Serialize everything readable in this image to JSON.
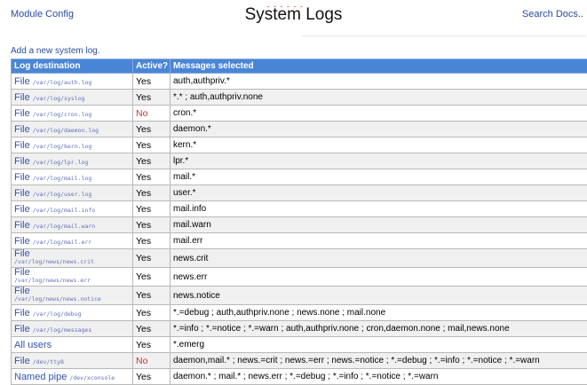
{
  "header": {
    "left_link": "Module Config",
    "title": "System Logs",
    "title_decoration": "- - - - - -",
    "right_link": "Search Docs.."
  },
  "add_link": "Add a new system log.",
  "table": {
    "columns": [
      "Log destination",
      "Active?",
      "Messages selected"
    ],
    "rows": [
      {
        "kind": "File",
        "path": "/var/log/auth.log",
        "active": "Yes",
        "messages": "auth,authpriv.*"
      },
      {
        "kind": "File",
        "path": "/var/log/syslog",
        "active": "Yes",
        "messages": "*.* ; auth,authpriv.none"
      },
      {
        "kind": "File",
        "path": "/var/log/cron.log",
        "active": "No",
        "messages": "cron.*"
      },
      {
        "kind": "File",
        "path": "/var/log/daemon.log",
        "active": "Yes",
        "messages": "daemon.*"
      },
      {
        "kind": "File",
        "path": "/var/log/kern.log",
        "active": "Yes",
        "messages": "kern.*"
      },
      {
        "kind": "File",
        "path": "/var/log/lpr.log",
        "active": "Yes",
        "messages": "lpr.*"
      },
      {
        "kind": "File",
        "path": "/var/log/mail.log",
        "active": "Yes",
        "messages": "mail.*"
      },
      {
        "kind": "File",
        "path": "/var/log/user.log",
        "active": "Yes",
        "messages": "user.*"
      },
      {
        "kind": "File",
        "path": "/var/log/mail.info",
        "active": "Yes",
        "messages": "mail.info"
      },
      {
        "kind": "File",
        "path": "/var/log/mail.warn",
        "active": "Yes",
        "messages": "mail.warn"
      },
      {
        "kind": "File",
        "path": "/var/log/mail.err",
        "active": "Yes",
        "messages": "mail.err"
      },
      {
        "kind": "File",
        "path": "/var/log/news/news.crit",
        "active": "Yes",
        "messages": "news.crit",
        "tall": true
      },
      {
        "kind": "File",
        "path": "/var/log/news/news.err",
        "active": "Yes",
        "messages": "news.err",
        "tall": true
      },
      {
        "kind": "File",
        "path": "/var/log/news/news.notice",
        "active": "Yes",
        "messages": "news.notice",
        "tall": true
      },
      {
        "kind": "File",
        "path": "/var/log/debug",
        "active": "Yes",
        "messages": "*.=debug ; auth,authpriv.none ; news.none ; mail.none"
      },
      {
        "kind": "File",
        "path": "/var/log/messages",
        "active": "Yes",
        "messages": "*.=info ; *.=notice ; *.=warn ; auth,authpriv.none ; cron,daemon.none ; mail,news.none"
      },
      {
        "kind": "All users",
        "path": "",
        "active": "Yes",
        "messages": "*.emerg"
      },
      {
        "kind": "File",
        "path": "/dev/tty8",
        "active": "No",
        "messages": "daemon,mail.* ; news.=crit ; news.=err ; news.=notice ; *.=debug ; *.=info ; *.=notice ; *.=warn"
      },
      {
        "kind": "Named pipe",
        "path": "/dev/xconsole",
        "active": "Yes",
        "messages": "daemon.* ; mail.* ; news.err ; *.=debug ; *.=info ; *.=notice ; *.=warn"
      }
    ]
  },
  "colors": {
    "header_bg": "#4a86d6",
    "link": "#2a4aa0",
    "inactive": "#d03030"
  }
}
